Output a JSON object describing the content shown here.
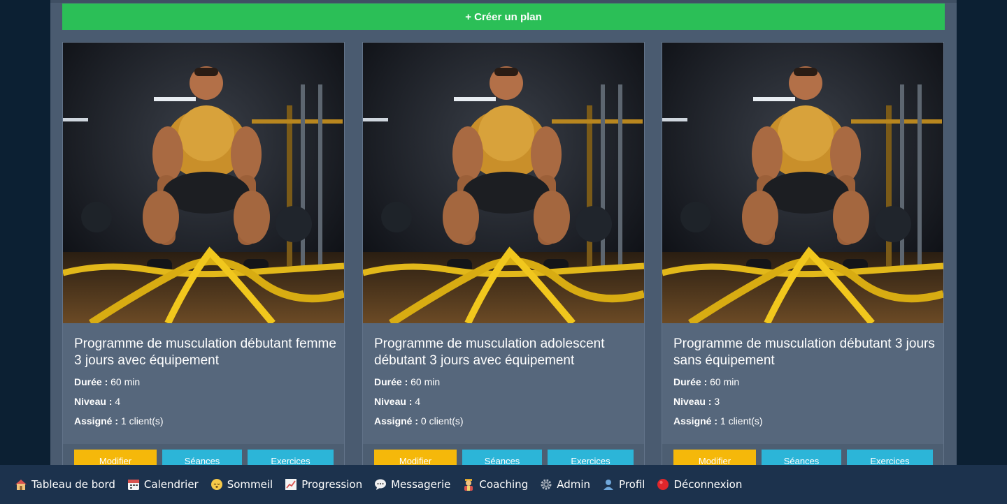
{
  "create_button": "+ Créer un plan",
  "cards": [
    {
      "title": "Programme de musculation débutant femme 3 jours avec équipement",
      "duration_label": "Durée :",
      "duration_value": "60 min",
      "level_label": "Niveau :",
      "level_value": "4",
      "assigned_label": "Assigné :",
      "assigned_value": "1 client(s)",
      "edit": "Modifier",
      "sessions": "Séances",
      "exercises": "Exercices"
    },
    {
      "title": "Programme de musculation adolescent débutant 3 jours avec équipement",
      "duration_label": "Durée :",
      "duration_value": "60 min",
      "level_label": "Niveau :",
      "level_value": "4",
      "assigned_label": "Assigné :",
      "assigned_value": "0 client(s)",
      "edit": "Modifier",
      "sessions": "Séances",
      "exercises": "Exercices"
    },
    {
      "title": "Programme de musculation débutant 3 jours sans équipement",
      "duration_label": "Durée :",
      "duration_value": "60 min",
      "level_label": "Niveau :",
      "level_value": "3",
      "assigned_label": "Assigné :",
      "assigned_value": "1 client(s)",
      "edit": "Modifier",
      "sessions": "Séances",
      "exercises": "Exercices"
    }
  ],
  "nav": [
    {
      "label": "Tableau de bord",
      "icon": "house-icon"
    },
    {
      "label": "Calendrier",
      "icon": "calendar-icon"
    },
    {
      "label": "Sommeil",
      "icon": "sleepy-face-icon"
    },
    {
      "label": "Progression",
      "icon": "chart-up-icon"
    },
    {
      "label": "Messagerie",
      "icon": "speech-bubble-icon"
    },
    {
      "label": "Coaching",
      "icon": "coach-icon"
    },
    {
      "label": "Admin",
      "icon": "gear-icon"
    },
    {
      "label": "Profil",
      "icon": "user-icon"
    },
    {
      "label": "Déconnexion",
      "icon": "red-circle-icon"
    }
  ],
  "colors": {
    "create": "#2bbf57",
    "edit": "#f5b80a",
    "info": "#2cb5d8",
    "panel": "#4a5b70",
    "nav": "#1c324d"
  }
}
